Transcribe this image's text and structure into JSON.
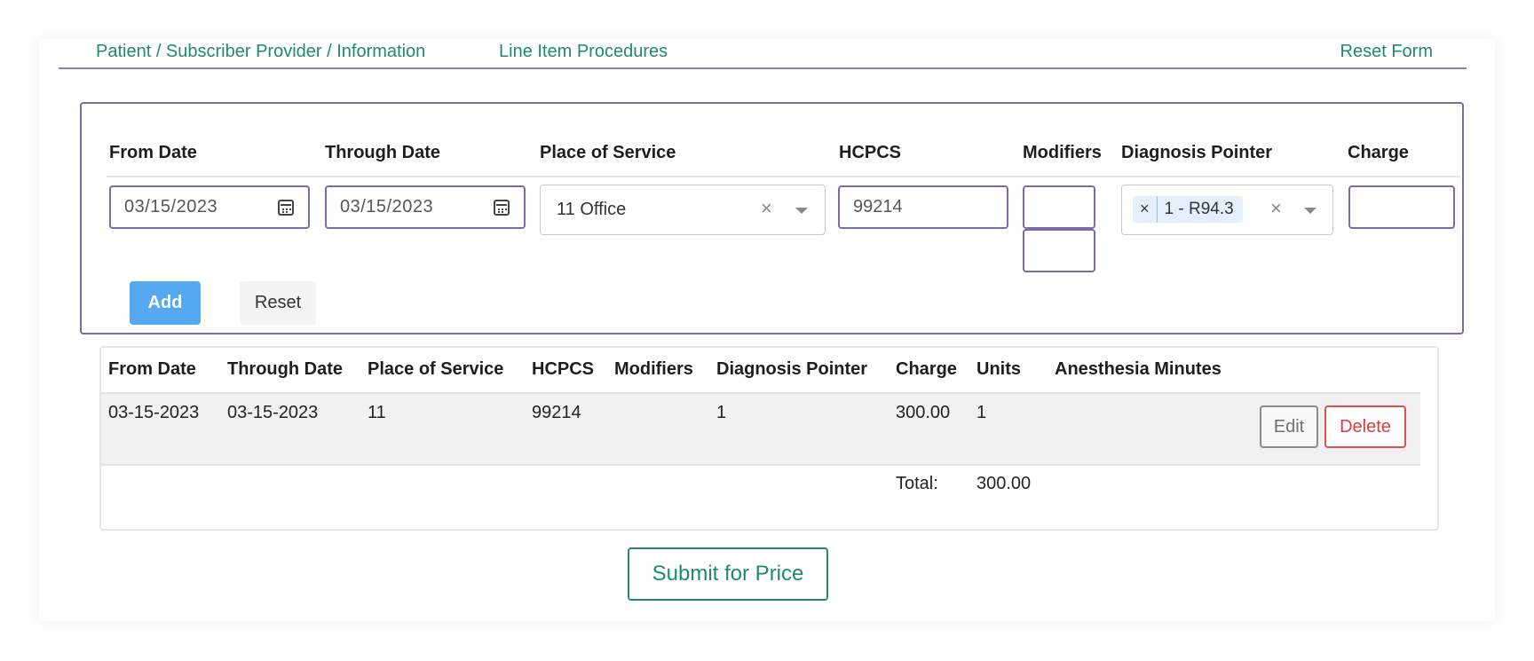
{
  "tabs": {
    "patient_info": "Patient / Subscriber Provider / Information",
    "line_items": "Line Item Procedures",
    "reset_form": "Reset Form"
  },
  "entry": {
    "headers": {
      "from_date": "From Date",
      "through_date": "Through Date",
      "place_of_service": "Place of Service",
      "hcpcs": "HCPCS",
      "modifiers": "Modifiers",
      "diagnosis_pointer": "Diagnosis Pointer",
      "charge": "Charge"
    },
    "from_date": "03/15/2023",
    "through_date": "03/15/2023",
    "place_of_service": "11 Office",
    "hcpcs": "99214",
    "modifier_1": "",
    "modifier_2": "",
    "diagnosis_chip": "1 - R94.3",
    "chip_remove": "×",
    "charge": "",
    "clear_symbol": "×",
    "add_label": "Add",
    "reset_label": "Reset"
  },
  "table": {
    "headers": {
      "from_date": "From Date",
      "through_date": "Through Date",
      "place_of_service": "Place of Service",
      "hcpcs": "HCPCS",
      "modifiers": "Modifiers",
      "diagnosis_pointer": "Diagnosis Pointer",
      "charge": "Charge",
      "units": "Units",
      "anesthesia_minutes": "Anesthesia Minutes"
    },
    "rows": [
      {
        "from_date": "03-15-2023",
        "through_date": "03-15-2023",
        "place_of_service": "11",
        "hcpcs": "99214",
        "modifiers": "",
        "diagnosis_pointer": "1",
        "charge": "300.00",
        "units": "1",
        "anesthesia_minutes": "",
        "edit_label": "Edit",
        "delete_label": "Delete"
      }
    ],
    "total_label": "Total:",
    "total_value": "300.00"
  },
  "submit_label": "Submit for Price",
  "colors": {
    "accent_green": "#1f8a6e",
    "border_purple": "#7e6aa6",
    "add_blue": "#55a9f3",
    "delete_red": "#d43f3a"
  }
}
